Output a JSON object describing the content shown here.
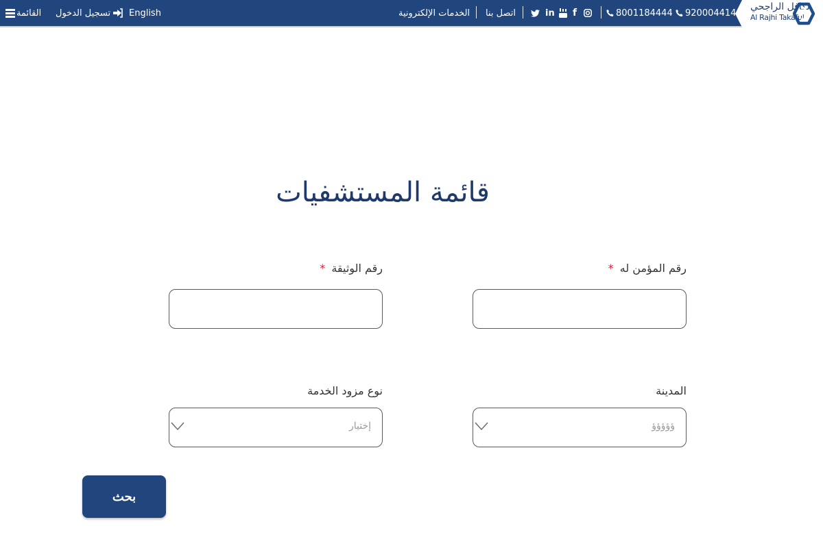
{
  "header": {
    "menu_label": "القائمة",
    "login_label": "تسجيل الدخول",
    "language_label": "English",
    "eservices_label": "الخدمات الإلكترونية",
    "contact_label": "اتصل بنا",
    "social": {
      "twitter": "𝕏",
      "linkedin": "in",
      "youtube": "You",
      "facebook": "f",
      "instagram": "◎"
    },
    "phone_1": "8001184444",
    "phone_2": "920004414",
    "logo_ar": "تكافل الراجحي",
    "logo_en": "Al Rajhi Takaful",
    "colors": {
      "bar": "#21467d",
      "brand": "#1f3f73"
    }
  },
  "main": {
    "title": "قائمة المستشفيات",
    "fields": {
      "insured_id": {
        "label": "رقم المؤمن له",
        "required_mark": "*",
        "value": ""
      },
      "policy_number": {
        "label": "رقم الوثيقة",
        "required_mark": "*",
        "value": ""
      },
      "city": {
        "label": "المدينة",
        "placeholder": "ؤؤؤؤؤ"
      },
      "provider_type": {
        "label": "نوع مزود الخدمة",
        "placeholder": "إختيار"
      }
    },
    "search_label": "بحث"
  }
}
